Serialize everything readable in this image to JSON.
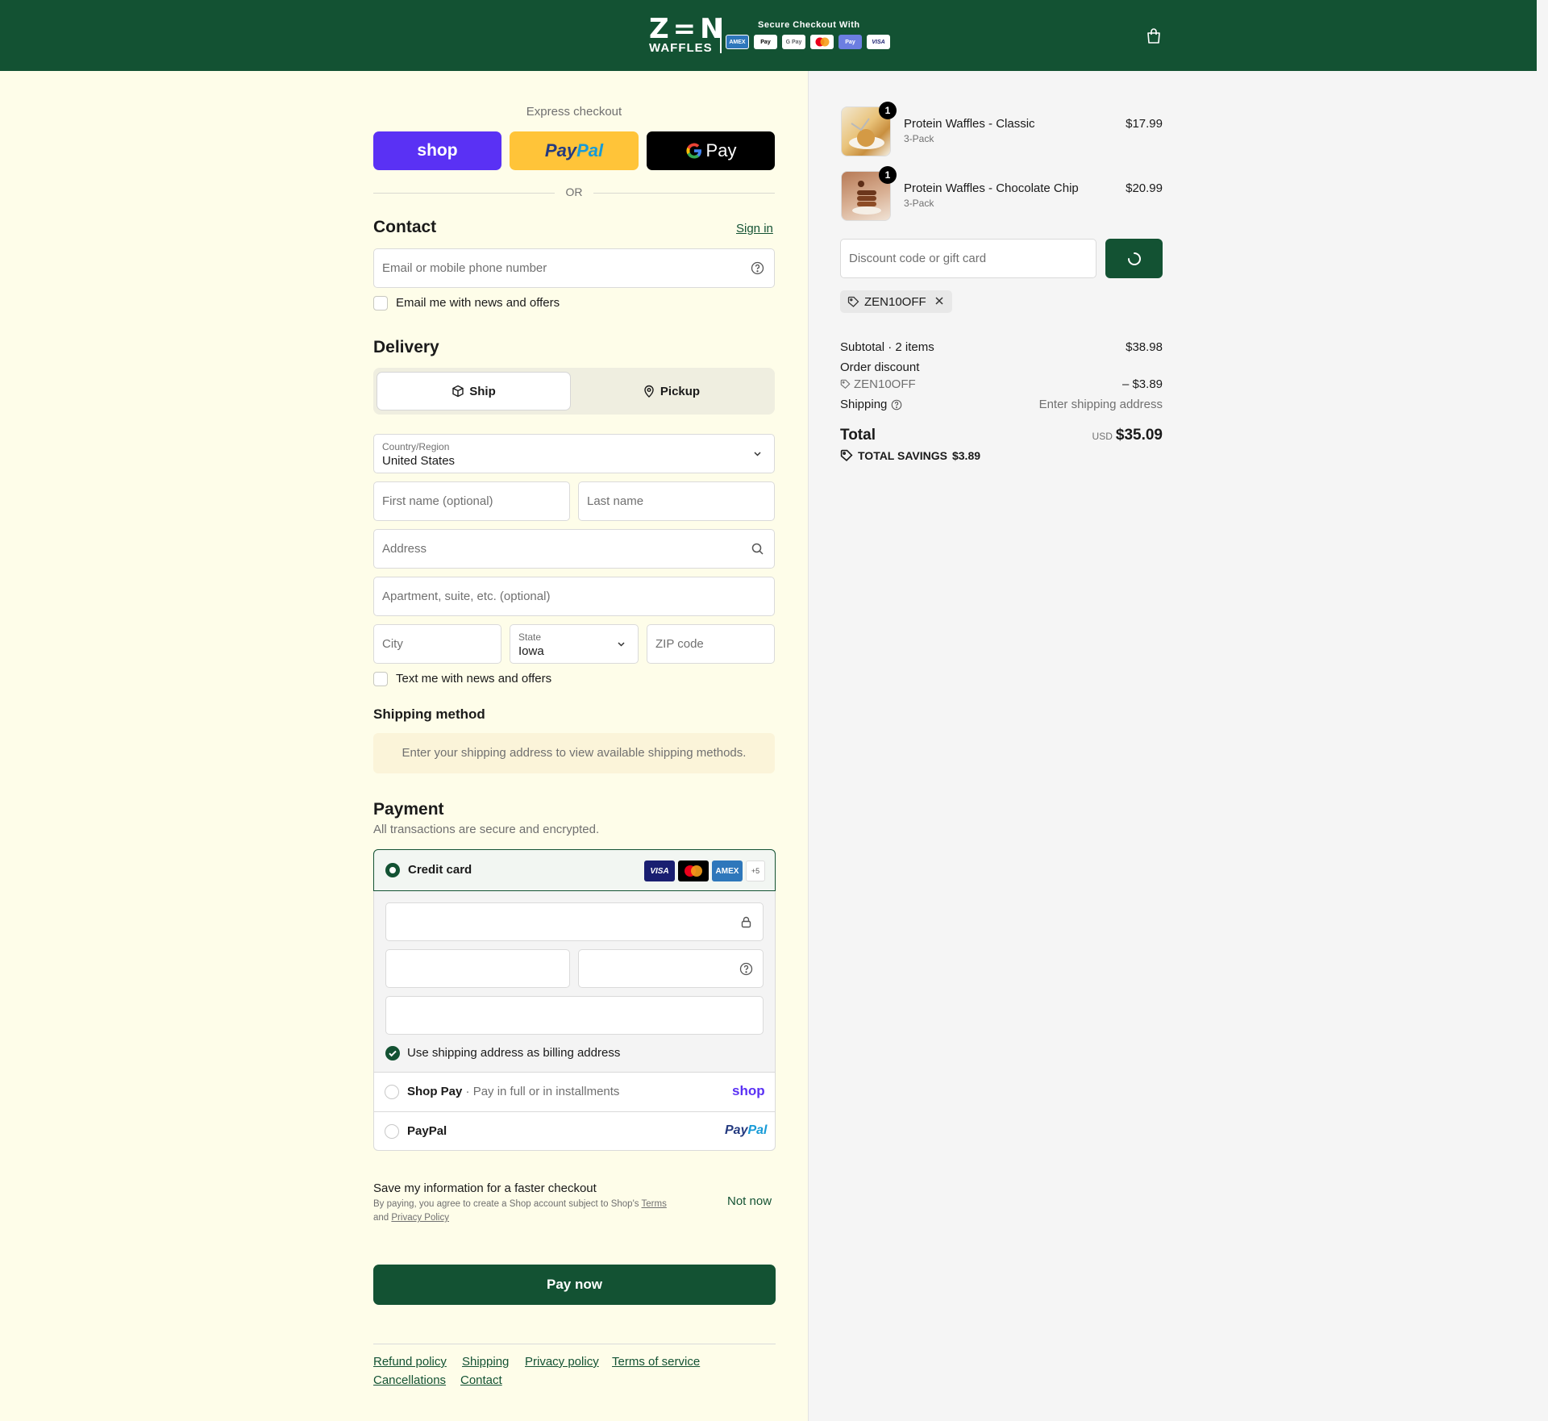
{
  "header": {
    "brand_top": "Z=N",
    "brand_bottom": "WAFFLES",
    "secure_text": "Secure Checkout With",
    "payment_icons": [
      "AMEX",
      "Apple Pay",
      "G Pay",
      "Mastercard",
      "Samsung Pay",
      "VISA"
    ]
  },
  "express": {
    "label": "Express checkout",
    "shop_label": "shop",
    "paypal_label_1": "Pay",
    "paypal_label_2": "Pal",
    "gpay_label": "Pay",
    "or_label": "OR"
  },
  "contact": {
    "title": "Contact",
    "sign_in": "Sign in",
    "email_placeholder": "Email or mobile phone number",
    "news_label": "Email me with news and offers"
  },
  "delivery": {
    "title": "Delivery",
    "ship_label": "Ship",
    "pickup_label": "Pickup",
    "country_label": "Country/Region",
    "country_value": "United States",
    "first_name_placeholder": "First name (optional)",
    "last_name_placeholder": "Last name",
    "address_placeholder": "Address",
    "apartment_placeholder": "Apartment, suite, etc. (optional)",
    "city_placeholder": "City",
    "state_label": "State",
    "state_value": "Iowa",
    "zip_placeholder": "ZIP code",
    "text_news_label": "Text me with news and offers"
  },
  "shipping_method": {
    "title": "Shipping method",
    "info": "Enter your shipping address to view available shipping methods."
  },
  "payment": {
    "title": "Payment",
    "subtitle": "All transactions are secure and encrypted.",
    "credit_card_label": "Credit card",
    "card_badges": [
      "VISA",
      "MC",
      "AMEX"
    ],
    "more_cards": "+5",
    "billing_label": "Use shipping address as billing address",
    "shop_pay_label": "Shop Pay",
    "shop_pay_sub": " · Pay in full or in installments",
    "shop_pay_logo": "shop",
    "paypal_label": "PayPal",
    "paypal_logo_1": "Pay",
    "paypal_logo_2": "Pal"
  },
  "save_info": {
    "title": "Save my information for a faster checkout",
    "legal_1": "By paying, you agree to create a Shop account subject to Shop's ",
    "terms": "Terms",
    "legal_2": "and ",
    "privacy": "Privacy Policy",
    "not_now": "Not now"
  },
  "pay_now_label": "Pay now",
  "footer_links": [
    "Refund policy",
    "Shipping",
    "Privacy policy",
    "Terms of service",
    "Cancellations",
    "Contact"
  ],
  "cart": {
    "items": [
      {
        "name": "Protein Waffles - Classic",
        "variant": "3-Pack",
        "price": "$17.99",
        "qty": "1"
      },
      {
        "name": "Protein Waffles - Chocolate Chip",
        "variant": "3-Pack",
        "price": "$20.99",
        "qty": "1"
      }
    ],
    "discount_placeholder": "Discount code or gift card",
    "applied_code": "ZEN10OFF",
    "subtotal_label": "Subtotal · 2 items",
    "subtotal_value": "$38.98",
    "order_discount_label": "Order discount",
    "discount_code": "ZEN10OFF",
    "discount_value": "– $3.89",
    "shipping_label": "Shipping",
    "shipping_value": "Enter shipping address",
    "total_label": "Total",
    "currency": "USD",
    "total_value": "$35.09",
    "savings_label": "TOTAL SAVINGS",
    "savings_value": "$3.89"
  },
  "colors": {
    "brand_green": "#135233",
    "page_cream": "#fefde9",
    "shop_purple": "#5a31f4",
    "paypal_yellow": "#ffc439"
  }
}
